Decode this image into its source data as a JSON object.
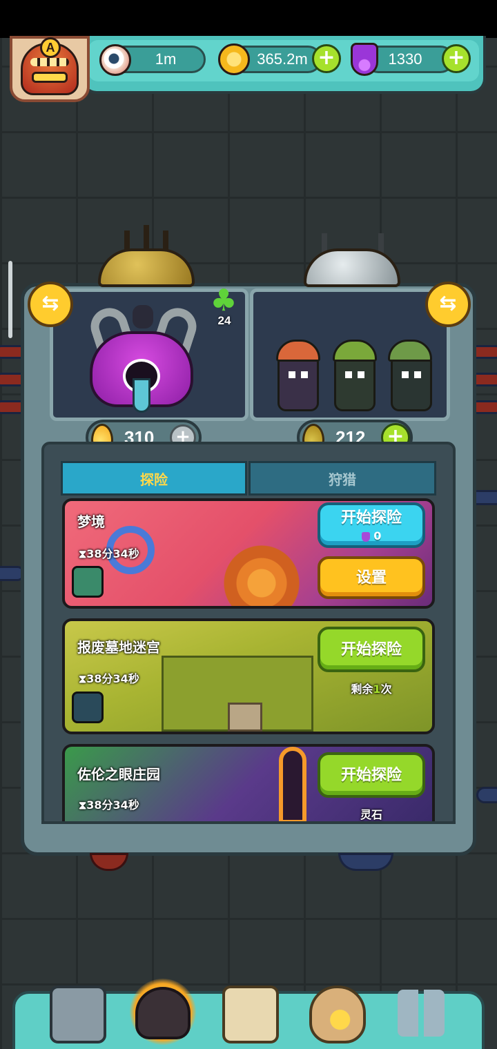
{
  "header": {
    "rank_letter": "A",
    "eye_value": "1m",
    "coins_value": "365.2m",
    "potion_value": "1330",
    "plus_symbol": "+"
  },
  "squads": {
    "swap_symbol": "⇆",
    "clover_count": "24",
    "left_energy": "310",
    "right_energy": "212"
  },
  "tabs": {
    "explore_label": "探险",
    "hunt_label": "狩猎"
  },
  "dungeons": [
    {
      "title": "梦境",
      "timer": "38分34秒",
      "start_label": "开始探险",
      "cost": "0",
      "settings_label": "设置"
    },
    {
      "title": "报废墓地迷宫",
      "timer": "38分34秒",
      "start_label": "开始探险",
      "remaining_prefix": "剩余",
      "remaining_count": "1",
      "remaining_suffix": "次"
    },
    {
      "title": "佐伦之眼庄园",
      "timer": "38分34秒",
      "start_label": "开始探险",
      "reward_label": "灵石"
    }
  ],
  "icons": {
    "timer_glyph": "⧗",
    "eye_icon": "eye-icon",
    "coin_icon": "coin-icon",
    "potion_icon": "potion-icon"
  },
  "colors": {
    "accent_teal": "#4fc3bd",
    "button_green": "#95d82a",
    "button_cyan": "#3bd4f0",
    "button_yellow": "#ffc21f",
    "tab_active_text": "#ffd84a"
  }
}
